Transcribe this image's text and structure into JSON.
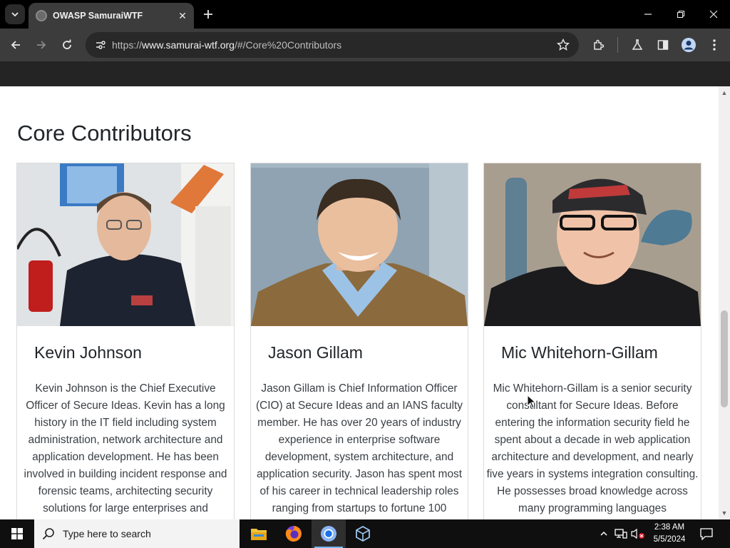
{
  "browser": {
    "tab_title": "OWASP SamuraiWTF",
    "url_scheme": "https://",
    "url_host": "www.samurai-wtf.org",
    "url_path": "/#/Core%20Contributors"
  },
  "page": {
    "section_title": "Core Contributors",
    "contributors": [
      {
        "name": "Kevin Johnson",
        "bio": "Kevin Johnson is the Chief Executive Officer of Secure Ideas. Kevin has a long history in the IT field including system administration, network architecture and application development. He has been involved in building incident response and forensic teams, architecting security solutions for large enterprises and"
      },
      {
        "name": "Jason Gillam",
        "bio": "Jason Gillam is Chief Information Officer (CIO) at Secure Ideas and an IANS faculty member. He has over 20 years of industry experience in enterprise software development, system architecture, and application security. Jason has spent most of his career in technical leadership roles ranging from startups to fortune 100"
      },
      {
        "name": "Mic Whitehorn-Gillam",
        "bio": "Mic Whitehorn-Gillam is a senior security consultant for Secure Ideas. Before entering the information security field he spent about a decade in web application architecture and development, and nearly five years in systems integration consulting. He possesses broad knowledge across many programming languages"
      }
    ]
  },
  "taskbar": {
    "search_placeholder": "Type here to search",
    "time": "2:38 AM",
    "date": "5/5/2024"
  },
  "icons": {
    "tab_search": "chevron-down-icon",
    "tab_close": "close-icon",
    "new_tab": "plus-icon",
    "back": "arrow-left-icon",
    "forward": "arrow-right-icon",
    "reload": "reload-icon",
    "site_info": "tune-icon",
    "bookmark": "star-icon",
    "extensions": "puzzle-icon",
    "labs": "flask-icon",
    "side_panel": "side-panel-icon",
    "profile": "profile-icon",
    "menu": "kebab-menu-icon"
  },
  "colors": {
    "browser_frame": "#000000",
    "toolbar": "#3c3c3c",
    "page_background": "#ffffff",
    "text_dark": "#212529",
    "taskbar": "#0f0f0f"
  }
}
